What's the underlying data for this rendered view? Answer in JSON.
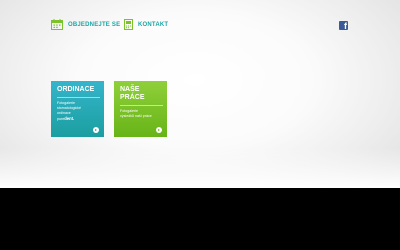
{
  "nav": {
    "calendar_label": "OBJEDNEJTE SE",
    "contact_label": "KONTAKT",
    "facebook_glyph": "f"
  },
  "cards": {
    "ordinace": {
      "title": "ORDINACE",
      "desc_lines": [
        "Fotogalerie",
        "stomatologické",
        "ordinace"
      ],
      "brand_prefix": "pure",
      "brand_bold": "dent."
    },
    "prace": {
      "title_line1": "NAŠE",
      "title_line2": "PRÁCE",
      "desc_lines": [
        "Fotogalerie",
        "výsledků naší práce"
      ]
    }
  },
  "colors": {
    "teal": "#1ca5a4",
    "green": "#7cc22a",
    "facebook": "#3b5998"
  }
}
